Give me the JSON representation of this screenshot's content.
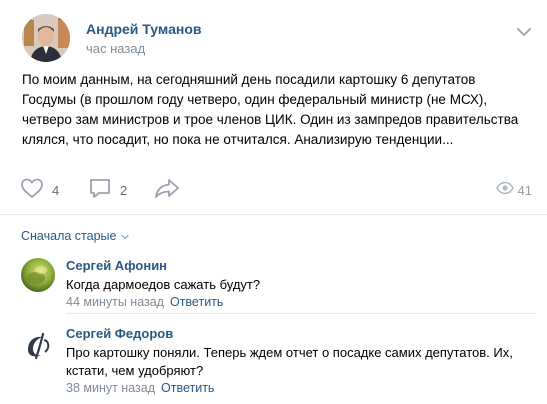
{
  "post": {
    "author": "Андрей Туманов",
    "time": "час назад",
    "text": "По моим данным, на сегодняшний день посадили картошку 6 депутатов Госдумы (в прошлом году четверо, один федеральный министр (не МСХ), четверо зам министров и трое членов ЦИК. Один из зампредов правительства клялся, что посадит, но пока не отчитался. Анализирую тенденции...",
    "likes": "4",
    "comments": "2",
    "views": "41"
  },
  "comments": {
    "sort_label": "Сначала старые",
    "items": [
      {
        "author": "Сергей Афонин",
        "text": "Когда дармоедов сажать будут?",
        "time": "44 минуты назад",
        "reply": "Ответить"
      },
      {
        "author": "Сергей Федоров",
        "text": "Про картошку поняли. Теперь ждем отчет о посадке самих депутатов. Их, кстати, чем удобряют?",
        "time": "38 минут назад",
        "reply": "Ответить"
      }
    ]
  },
  "icons": {
    "like": "heart-icon",
    "comment": "comment-bubble-icon",
    "share": "share-arrow-icon",
    "views": "eye-icon",
    "menu": "chevron-down-icon",
    "sort": "chevron-down-icon"
  },
  "colors": {
    "link": "#2a5885",
    "secondary": "#818c99",
    "icon": "#99a2ad",
    "divider": "#e7e8ec"
  }
}
